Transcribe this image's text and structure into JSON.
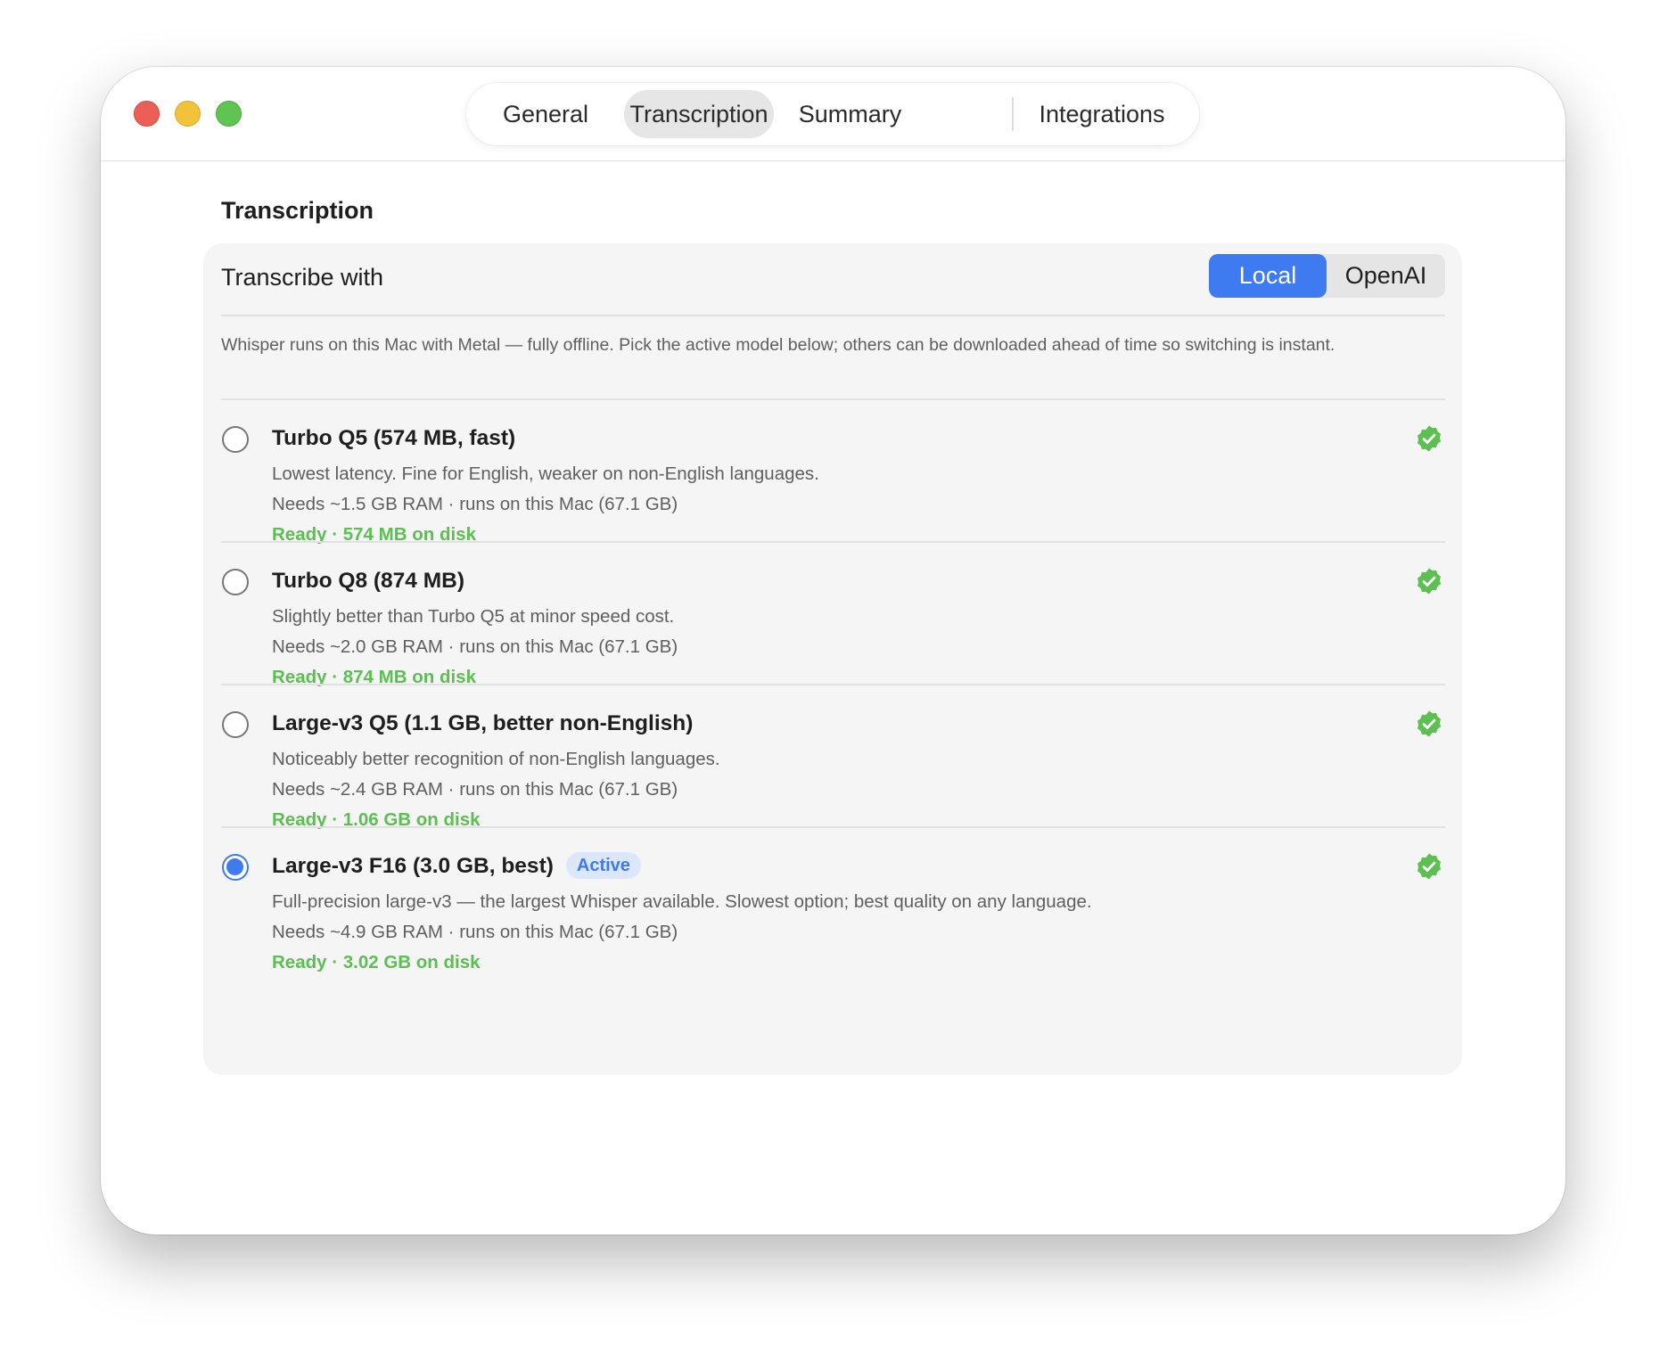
{
  "window": {
    "tabs": [
      {
        "label": "General"
      },
      {
        "label": "Transcription"
      },
      {
        "label": "Summary"
      },
      {
        "label": "Integrations"
      }
    ],
    "active_tab": "Transcription"
  },
  "section": {
    "title": "Transcription"
  },
  "transcribe_with": {
    "label": "Transcribe with",
    "options": [
      "Local",
      "OpenAI"
    ],
    "selected": "Local"
  },
  "description": "Whisper runs on this Mac with Metal — fully offline. Pick the active model below; others can be downloaded ahead of time so switching is instant.",
  "models": [
    {
      "title": "Turbo Q5 (574 MB, fast)",
      "summary": "Lowest latency. Fine for English, weaker on non-English languages.",
      "requirements": "Needs ~1.5 GB RAM · runs on this Mac (67.1 GB)",
      "status": "Ready · 574 MB on disk",
      "selected": false
    },
    {
      "title": "Turbo Q8 (874 MB)",
      "summary": "Slightly better than Turbo Q5 at minor speed cost.",
      "requirements": "Needs ~2.0 GB RAM · runs on this Mac (67.1 GB)",
      "status": "Ready · 874 MB on disk",
      "selected": false
    },
    {
      "title": "Large-v3 Q5 (1.1 GB, better non-English)",
      "summary": "Noticeably better recognition of non-English languages.",
      "requirements": "Needs ~2.4 GB RAM · runs on this Mac (67.1 GB)",
      "status": "Ready · 1.06 GB on disk",
      "selected": false
    },
    {
      "title": "Large-v3 F16 (3.0 GB, best)",
      "badge": "Active",
      "summary": "Full-precision large-v3 — the largest Whisper available. Slowest option; best quality on any language.",
      "requirements": "Needs ~4.9 GB RAM · runs on this Mac (67.1 GB)",
      "status": "Ready · 3.02 GB on disk",
      "selected": true
    }
  ],
  "colors": {
    "accent": "#3e7af0",
    "ready_green": "#5cbf52",
    "traffic_red": "#ec5f57",
    "traffic_yellow": "#f2c23b",
    "traffic_green": "#5fc451"
  },
  "icons": {
    "status_icon": "verified-check-badge-icon",
    "window_controls": [
      "close-icon",
      "minimize-icon",
      "zoom-icon"
    ]
  }
}
